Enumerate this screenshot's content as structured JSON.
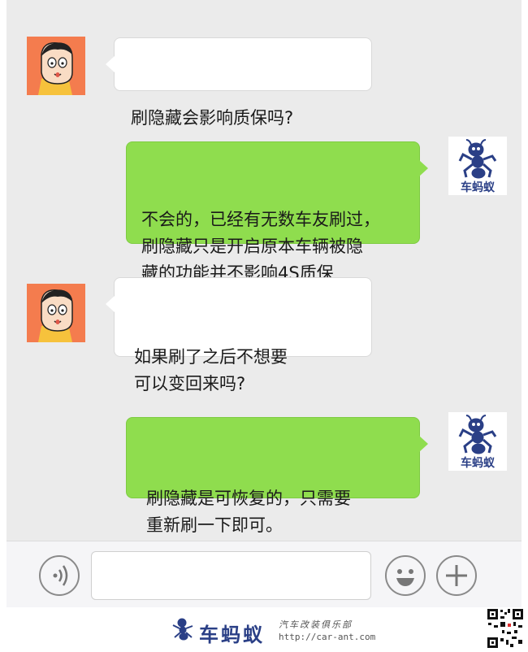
{
  "messages": [
    {
      "side": "in",
      "text": "刷隐藏会影响质保吗?"
    },
    {
      "side": "out",
      "text": "不会的，已经有无数车友刷过，\n刷隐藏只是开启原本车辆被隐\n藏的功能并不影响4S质保"
    },
    {
      "side": "in",
      "text": "如果刷了之后不想要\n可以变回来吗?"
    },
    {
      "side": "out",
      "text": "刷隐藏是可恢复的，只需要\n重新刷一下即可。"
    }
  ],
  "out_avatar": {
    "label": "车蚂蚁",
    "icon": "ant-logo-icon"
  },
  "in_avatar": {
    "icon": "cartoon-boy-avatar-icon"
  },
  "input_bar": {
    "voice_icon": "voice-icon",
    "text_value": "",
    "emoji_icon": "emoji-icon",
    "plus_icon": "plus-icon"
  },
  "footer": {
    "brand": "车蚂蚁",
    "subtitle": "汽车改装俱乐部",
    "url": "http://car-ant.com"
  },
  "colors": {
    "chat_bg": "#ebebeb",
    "out_bubble": "#8fdd4e",
    "in_bubble": "#ffffff",
    "avatar_orange": "#f47c4e",
    "brand_blue": "#2a3f86"
  }
}
